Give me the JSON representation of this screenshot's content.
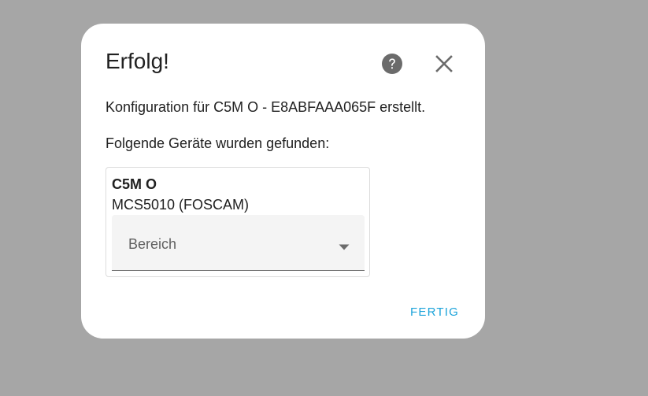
{
  "dialog": {
    "title": "Erfolg!",
    "config_message": "Konfiguration für C5M O - E8ABFAAA065F erstellt.",
    "found_message": "Folgende Geräte wurden gefunden:",
    "done_label": "FERTIG"
  },
  "device": {
    "name": "C5M O",
    "model": "MCS5010 (FOSCAM)",
    "area_placeholder": "Bereich"
  },
  "icons": {
    "help": "help-circle-icon",
    "close": "close-icon",
    "dropdown": "menu-down-icon"
  },
  "colors": {
    "backdrop": "#a6a6a6",
    "accent": "#1ba3da",
    "icon": "#6b6b6b"
  }
}
